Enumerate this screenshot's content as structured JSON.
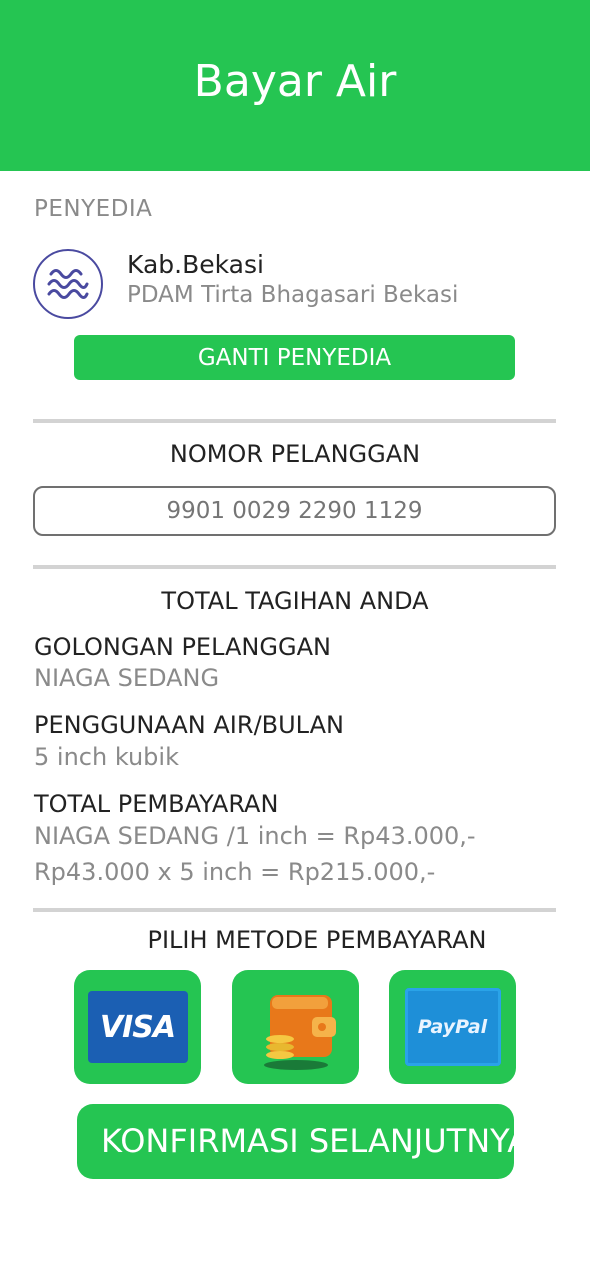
{
  "header": {
    "title": "Bayar Air"
  },
  "provider": {
    "section_label": "PENYEDIA",
    "logo_icon": "water-waves-icon",
    "name": "Kab.Bekasi",
    "company": "PDAM Tirta Bhagasari Bekasi",
    "change_button": "GANTI PENYEDIA"
  },
  "customer": {
    "heading": "NOMOR PELANGGAN",
    "number_placeholder": "9901 0029 2290 1129"
  },
  "bill": {
    "heading": "TOTAL TAGIHAN ANDA",
    "group_label": "GOLONGAN PELANGGAN",
    "group_value": "NIAGA SEDANG",
    "usage_label": "PENGGUNAAN AIR/BULAN",
    "usage_value": "5 inch kubik",
    "total_label": "TOTAL PEMBAYARAN",
    "total_line1": "NIAGA SEDANG /1 inch = Rp43.000,-",
    "total_line2": "Rp43.000 x 5 inch = Rp215.000,-"
  },
  "payment": {
    "heading": "PILIH METODE PEMBAYARAN",
    "methods": [
      {
        "label": "VISA",
        "icon": "visa-card-icon"
      },
      {
        "label": "",
        "icon": "wallet-icon"
      },
      {
        "label": "PayPal",
        "icon": "paypal-icon"
      }
    ]
  },
  "confirm_button": "KONFIRMASI SELANJUTNYA",
  "colors": {
    "primary": "#25c552",
    "visa_blue": "#1b5fb3",
    "paypal_blue": "#1e8fd8",
    "wallet_orange": "#e8781a"
  }
}
